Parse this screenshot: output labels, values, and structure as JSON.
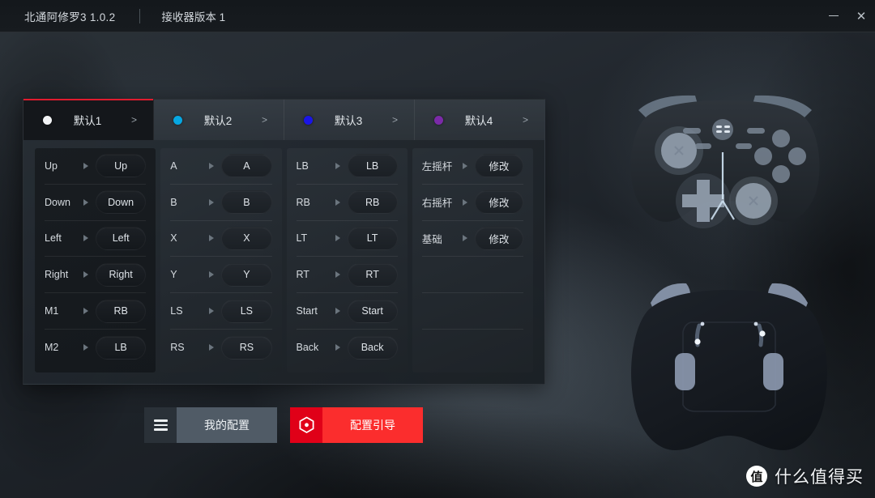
{
  "titlebar": {
    "app_title": "北通阿修罗3  1.0.2",
    "receiver_label": "接收器版本  1",
    "minimize_tooltip": "—",
    "close_glyph": "✕"
  },
  "tabs": [
    {
      "label": "默认1",
      "dot_color": "#f2f4f6",
      "arrow": ">",
      "active": true
    },
    {
      "label": "默认2",
      "dot_color": "#06a7e2",
      "arrow": ">",
      "active": false
    },
    {
      "label": "默认3",
      "dot_color": "#1a15e6",
      "arrow": ">",
      "active": false
    },
    {
      "label": "默认4",
      "dot_color": "#7b2aa8",
      "arrow": ">",
      "active": false
    }
  ],
  "columns": [
    {
      "name": "dpad-and-macro",
      "rows": [
        {
          "label": "Up",
          "value": "Up"
        },
        {
          "label": "Down",
          "value": "Down"
        },
        {
          "label": "Left",
          "value": "Left"
        },
        {
          "label": "Right",
          "value": "Right"
        },
        {
          "label": "M1",
          "value": "RB"
        },
        {
          "label": "M2",
          "value": "LB"
        }
      ]
    },
    {
      "name": "face-buttons",
      "rows": [
        {
          "label": "A",
          "value": "A"
        },
        {
          "label": "B",
          "value": "B"
        },
        {
          "label": "X",
          "value": "X"
        },
        {
          "label": "Y",
          "value": "Y"
        },
        {
          "label": "LS",
          "value": "LS"
        },
        {
          "label": "RS",
          "value": "RS"
        }
      ]
    },
    {
      "name": "shoulder-and-system",
      "rows": [
        {
          "label": "LB",
          "value": "LB"
        },
        {
          "label": "RB",
          "value": "RB"
        },
        {
          "label": "LT",
          "value": "LT"
        },
        {
          "label": "RT",
          "value": "RT"
        },
        {
          "label": "Start",
          "value": "Start"
        },
        {
          "label": "Back",
          "value": "Back"
        }
      ]
    },
    {
      "name": "sticks-and-base",
      "rows": [
        {
          "label": "左摇杆",
          "value": "修改"
        },
        {
          "label": "右摇杆",
          "value": "修改"
        },
        {
          "label": "基础",
          "value": "修改"
        },
        {
          "label": "",
          "value": ""
        },
        {
          "label": "",
          "value": ""
        },
        {
          "label": "",
          "value": ""
        }
      ]
    }
  ],
  "footer_buttons": [
    {
      "label": "我的配置",
      "icon": "hamburger-icon",
      "color": "#505b66"
    },
    {
      "label": "配置引导",
      "icon": "hexagon-gear-icon",
      "color": "#fb2d2d"
    }
  ],
  "watermark": {
    "logo_char": "值",
    "text": "什么值得买"
  },
  "preview": {
    "front_view_label": "controller-front-view",
    "back_view_label": "controller-back-view"
  }
}
